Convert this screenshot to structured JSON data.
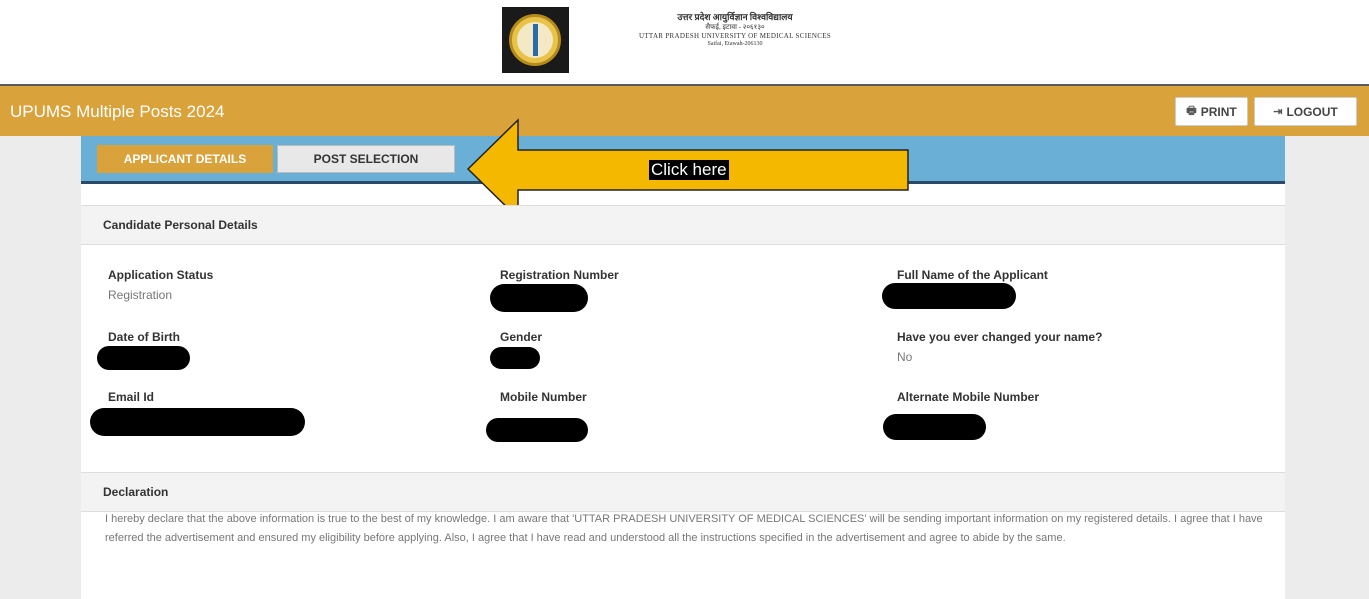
{
  "logo": {
    "line1": "उत्तर प्रदेश आयुर्विज्ञान विश्वविद्यालय",
    "line2": "सैफई, इटावा - २०६१३०",
    "line3": "UTTAR PRADESH UNIVERSITY OF MEDICAL SCIENCES",
    "line4": "Saifai, Etawah-206130"
  },
  "header": {
    "title": "UPUMS Multiple Posts 2024",
    "print_label": "PRINT",
    "logout_label": "LOGOUT"
  },
  "tabs": [
    {
      "label": "APPLICANT DETAILS",
      "active": true
    },
    {
      "label": "POST SELECTION",
      "active": false
    }
  ],
  "annotation": {
    "text": "Click here",
    "color": "#f5b800"
  },
  "personal": {
    "heading": "Candidate Personal Details",
    "fields": [
      {
        "label": "Application Status",
        "value": "Registration"
      },
      {
        "label": "Registration Number",
        "value": ""
      },
      {
        "label": "Full Name of the Applicant",
        "value": ""
      },
      {
        "label": "Date of Birth",
        "value": ""
      },
      {
        "label": "Gender",
        "value": ""
      },
      {
        "label": "Have you ever changed your name?",
        "value": "No"
      },
      {
        "label": "Email Id",
        "value": ""
      },
      {
        "label": "Mobile Number",
        "value": ""
      },
      {
        "label": "Alternate Mobile Number",
        "value": ""
      }
    ]
  },
  "declaration": {
    "heading": "Declaration",
    "text": "I hereby declare that the above information is true to the best of my knowledge. I am aware that 'UTTAR PRADESH UNIVERSITY OF MEDICAL SCIENCES' will be sending important information on my registered details. I agree that I have referred the advertisement and ensured my eligibility before applying. Also, I agree that I have read and understood all the instructions specified in the advertisement and agree to abide by the same."
  },
  "colors": {
    "brand": "#d9a23a",
    "tabbar": "#6ab0d6"
  }
}
